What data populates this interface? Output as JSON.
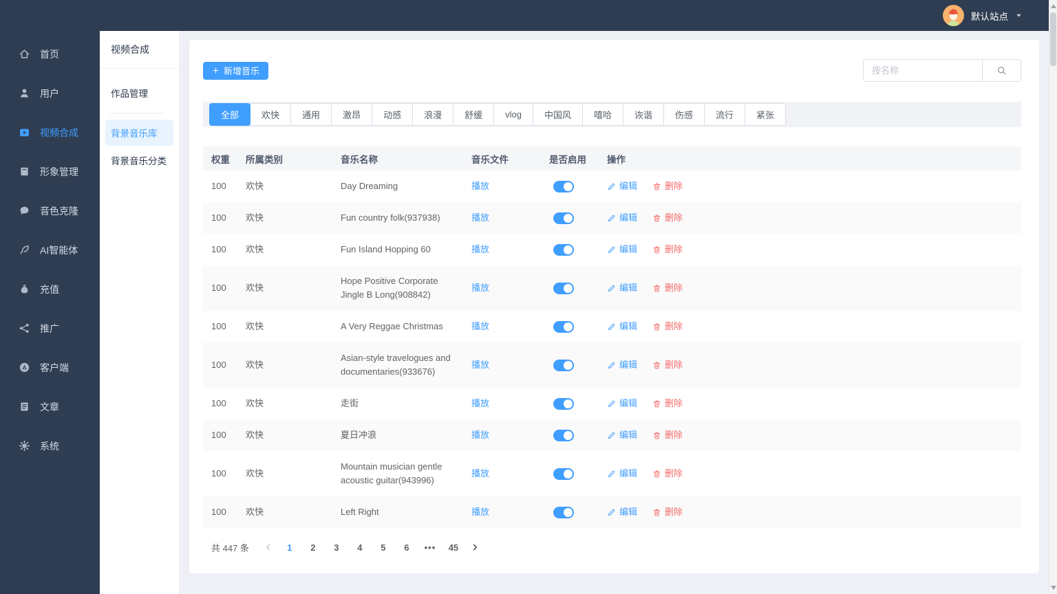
{
  "topbar": {
    "site_name": "默认站点"
  },
  "sidebar": {
    "items": [
      {
        "key": "home",
        "icon": "home",
        "label": "首页",
        "active": false
      },
      {
        "key": "users",
        "icon": "user",
        "label": "用户",
        "active": false
      },
      {
        "key": "video-compose",
        "icon": "video",
        "label": "视频合成",
        "active": true
      },
      {
        "key": "figure-manage",
        "icon": "figure",
        "label": "形象管理",
        "active": false
      },
      {
        "key": "voice-clone",
        "icon": "voice",
        "label": "音色克隆",
        "active": false
      },
      {
        "key": "ai-agent",
        "icon": "feather",
        "label": "AI智能体",
        "active": false
      },
      {
        "key": "recharge",
        "icon": "moneybag",
        "label": "充值",
        "active": false
      },
      {
        "key": "promotion",
        "icon": "share",
        "label": "推广",
        "active": false
      },
      {
        "key": "client",
        "icon": "app",
        "label": "客户端",
        "active": false
      },
      {
        "key": "articles",
        "icon": "document",
        "label": "文章",
        "active": false
      },
      {
        "key": "system",
        "icon": "gear",
        "label": "系统",
        "active": false
      }
    ]
  },
  "submenu": {
    "title": "视频合成",
    "items": [
      {
        "key": "works-manage",
        "label": "作品管理",
        "active": false,
        "divider_after": true
      },
      {
        "key": "bgm-library",
        "label": "背景音乐库",
        "active": true
      },
      {
        "key": "bgm-category",
        "label": "背景音乐分类",
        "active": false
      }
    ]
  },
  "toolbar": {
    "add_music_label": "新增音乐",
    "search_placeholder": "按名称"
  },
  "tabs": [
    {
      "label": "全部",
      "active": true
    },
    {
      "label": "欢快"
    },
    {
      "label": "通用"
    },
    {
      "label": "激昂"
    },
    {
      "label": "动感"
    },
    {
      "label": "浪漫"
    },
    {
      "label": "舒缓"
    },
    {
      "label": "vlog"
    },
    {
      "label": "中国风"
    },
    {
      "label": "嘻哈"
    },
    {
      "label": "诙谐"
    },
    {
      "label": "伤感"
    },
    {
      "label": "流行"
    },
    {
      "label": "紧张"
    }
  ],
  "table": {
    "columns": [
      "权重",
      "所属类别",
      "音乐名称",
      "音乐文件",
      "是否启用",
      "操作"
    ],
    "play_label": "播放",
    "edit_label": "编辑",
    "delete_label": "删除",
    "rows": [
      {
        "weight": "100",
        "category": "欢快",
        "name": "Day Dreaming",
        "enabled": true
      },
      {
        "weight": "100",
        "category": "欢快",
        "name": "Fun country folk(937938)",
        "enabled": true
      },
      {
        "weight": "100",
        "category": "欢快",
        "name": "Fun Island Hopping 60",
        "enabled": true
      },
      {
        "weight": "100",
        "category": "欢快",
        "name": "Hope Positive Corporate Jingle B Long(908842)",
        "enabled": true
      },
      {
        "weight": "100",
        "category": "欢快",
        "name": "A Very Reggae Christmas",
        "enabled": true
      },
      {
        "weight": "100",
        "category": "欢快",
        "name": "Asian-style travelogues and documentaries(933676)",
        "enabled": true
      },
      {
        "weight": "100",
        "category": "欢快",
        "name": "走街",
        "enabled": true
      },
      {
        "weight": "100",
        "category": "欢快",
        "name": "夏日冲浪",
        "enabled": true
      },
      {
        "weight": "100",
        "category": "欢快",
        "name": "Mountain musician gentle acoustic guitar(943996)",
        "enabled": true
      },
      {
        "weight": "100",
        "category": "欢快",
        "name": "Left Right",
        "enabled": true
      }
    ]
  },
  "pagination": {
    "total_label": "共 447 条",
    "pages": [
      {
        "label": "1",
        "active": true
      },
      {
        "label": "2"
      },
      {
        "label": "3"
      },
      {
        "label": "4"
      },
      {
        "label": "5"
      },
      {
        "label": "6"
      },
      {
        "label": "•••",
        "ellipsis": true
      },
      {
        "label": "45"
      }
    ]
  },
  "colors": {
    "primary": "#409eff",
    "danger": "#f56c6c",
    "sidebar_bg": "#2f3d52",
    "active_menu_bg": "#e8f3fe"
  }
}
